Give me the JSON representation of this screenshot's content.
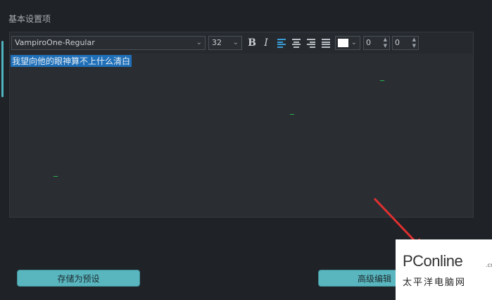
{
  "section": {
    "title": "基本设置项"
  },
  "toolbar": {
    "font_name": "VampiroOne-Regular",
    "font_size": "32",
    "bold_label": "B",
    "italic_label": "I",
    "text_color": "#ffffff",
    "spinner1": "0",
    "spinner2": "0"
  },
  "editor": {
    "selected_text": "我望向他的眼神算不上什么清白"
  },
  "buttons": {
    "save_preset": "存储为预设",
    "advanced_edit": "高级编辑"
  },
  "watermark": {
    "logo_text": "PConline",
    "domain_suffix": ".cn",
    "cn_text": "太平洋电脑网"
  },
  "colors": {
    "accent": "#59b6bf",
    "selection": "#1f6fb8",
    "annotation_arrow": "#e03030"
  }
}
